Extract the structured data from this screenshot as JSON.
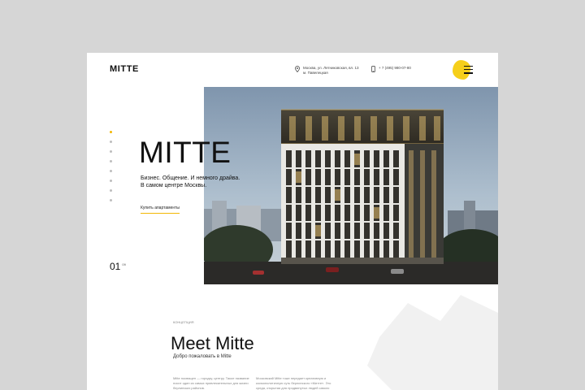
{
  "header": {
    "logo": "MITTE",
    "address_line1": "Москва, ул. Летниковская, вл. 13",
    "address_line2": "м. Павелецкая",
    "phone": "+ 7 (495) 980-07-80",
    "icons": [
      "location-pin-icon",
      "phone-icon",
      "menu-icon"
    ],
    "accent_color": "#f6cf1a"
  },
  "hero": {
    "title": "MITTE",
    "subtitle_line1": "Бизнес. Общение. И немного драйва.",
    "subtitle_line2": "В самом центре Москвы.",
    "cta_label": "Купить апартаменты",
    "counter_current": "01",
    "counter_total": "09",
    "pager_dots": 8,
    "pager_active_index": 0
  },
  "concept": {
    "label": "КОНЦЕПЦИЯ",
    "title": "Meet Mitte",
    "subtitle": "Добро пожаловать в Mitte",
    "col1": "Mitte посвящен — городку, центру. Такое название носит один из самых привлекательных для жизни берлинских районов.",
    "col2": "Московский Mitte тоже передает креативную и космополитичную суть берлинского «Митте». Это среда, открытая для продвинутых людей самого разного склада интересов."
  }
}
